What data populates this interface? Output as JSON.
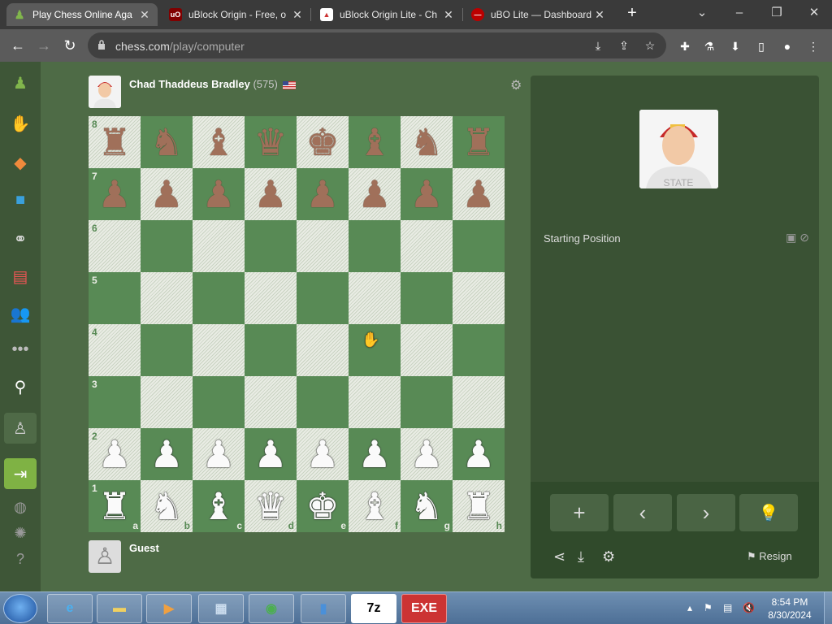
{
  "browser": {
    "tabs": [
      {
        "title": "Play Chess Online Aga",
        "favicon": "chess-pawn",
        "active": true
      },
      {
        "title": "uBlock Origin - Free, o",
        "favicon": "ublock-origin",
        "active": false
      },
      {
        "title": "uBlock Origin Lite - Ch",
        "favicon": "chrome-web-store",
        "active": false
      },
      {
        "title": "uBO Lite — Dashboard",
        "favicon": "ubo-lite",
        "active": false
      }
    ],
    "new_tab_symbol": "+",
    "url_domain": "chess.com",
    "url_path": "/play/computer"
  },
  "sidebar": {
    "items": [
      "play-pawn-icon",
      "puzzles-icon",
      "learn-icon",
      "lessons-icon",
      "watch-binoculars-icon",
      "news-icon",
      "social-icon",
      "more-dots-icon",
      "search-icon",
      "add-friend-icon",
      "signup-icon",
      "language-globe-icon",
      "theme-sun-icon",
      "help-icon"
    ]
  },
  "top_player": {
    "name": "Chad Thaddeus Bradley",
    "rating": "(575)",
    "country": "US"
  },
  "bottom_player": {
    "name": "Guest"
  },
  "board": {
    "ranks": [
      "8",
      "7",
      "6",
      "5",
      "4",
      "3",
      "2",
      "1"
    ],
    "files": [
      "a",
      "b",
      "c",
      "d",
      "e",
      "f",
      "g",
      "h"
    ],
    "rows": [
      [
        "♜",
        "♞",
        "♝",
        "♛",
        "♚",
        "♝",
        "♞",
        "♜"
      ],
      [
        "♟",
        "♟",
        "♟",
        "♟",
        "♟",
        "♟",
        "♟",
        "♟"
      ],
      [
        "",
        "",
        "",
        "",
        "",
        "",
        "",
        ""
      ],
      [
        "",
        "",
        "",
        "",
        "",
        "",
        "",
        ""
      ],
      [
        "",
        "",
        "",
        "",
        "",
        "",
        "",
        ""
      ],
      [
        "",
        "",
        "",
        "",
        "",
        "",
        "",
        ""
      ],
      [
        "♟",
        "♟",
        "♟",
        "♟",
        "♟",
        "♟",
        "♟",
        "♟"
      ],
      [
        "♜",
        "♞",
        "♝",
        "♛",
        "♚",
        "♝",
        "♞",
        "♜"
      ]
    ],
    "colors": {
      "light": "#e9ece4",
      "dark": "#588a55"
    }
  },
  "panel": {
    "status": "Starting Position",
    "resign_label": "Resign",
    "controls": [
      "+",
      "‹",
      "›",
      "💡"
    ]
  },
  "taskbar": {
    "apps": [
      "ie-icon",
      "explorer-icon",
      "media-player-icon",
      "control-panel-icon",
      "chrome-icon",
      "app-icon",
      "7z",
      "EXE"
    ],
    "time": "8:54 PM",
    "date": "8/30/2024"
  }
}
